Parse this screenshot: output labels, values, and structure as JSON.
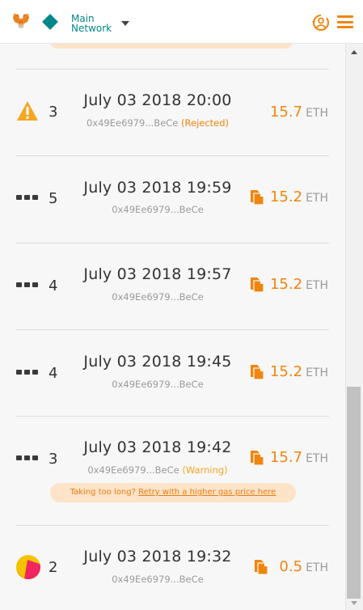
{
  "header": {
    "network_line1": "Main",
    "network_line2": "Network",
    "brand_color": "#f0850e",
    "network_color": "#038789"
  },
  "transactions": [
    {
      "status_icon": "warning-icon",
      "nonce": "3",
      "date": "July 03 2018 20:00",
      "address": "0x49Ee6979...BeCe",
      "tag": "(Rejected)",
      "amount": "15.7",
      "unit": "ETH",
      "show_copy": false
    },
    {
      "status_icon": "pending-dots-icon",
      "nonce": "5",
      "date": "July 03 2018 19:59",
      "address": "0x49Ee6979...BeCe",
      "tag": "",
      "amount": "15.2",
      "unit": "ETH",
      "show_copy": true
    },
    {
      "status_icon": "pending-dots-icon",
      "nonce": "4",
      "date": "July 03 2018 19:57",
      "address": "0x49Ee6979...BeCe",
      "tag": "",
      "amount": "15.2",
      "unit": "ETH",
      "show_copy": true
    },
    {
      "status_icon": "pending-dots-icon",
      "nonce": "4",
      "date": "July 03 2018 19:45",
      "address": "0x49Ee6979...BeCe",
      "tag": "",
      "amount": "15.2",
      "unit": "ETH",
      "show_copy": true
    },
    {
      "status_icon": "pending-dots-icon",
      "nonce": "3",
      "date": "July 03 2018 19:42",
      "address": "0x49Ee6979...BeCe",
      "tag": "(Warning)",
      "amount": "15.7",
      "unit": "ETH",
      "show_copy": true
    },
    {
      "status_icon": "identicon",
      "nonce": "2",
      "date": "July 03 2018 19:32",
      "address": "0x49Ee6979...BeCe",
      "tag": "",
      "amount": "0.5",
      "unit": "ETH",
      "show_copy": true
    }
  ],
  "gas_banner": {
    "prefix": "Taking too long? ",
    "link": "Retry with a higher gas price here"
  }
}
